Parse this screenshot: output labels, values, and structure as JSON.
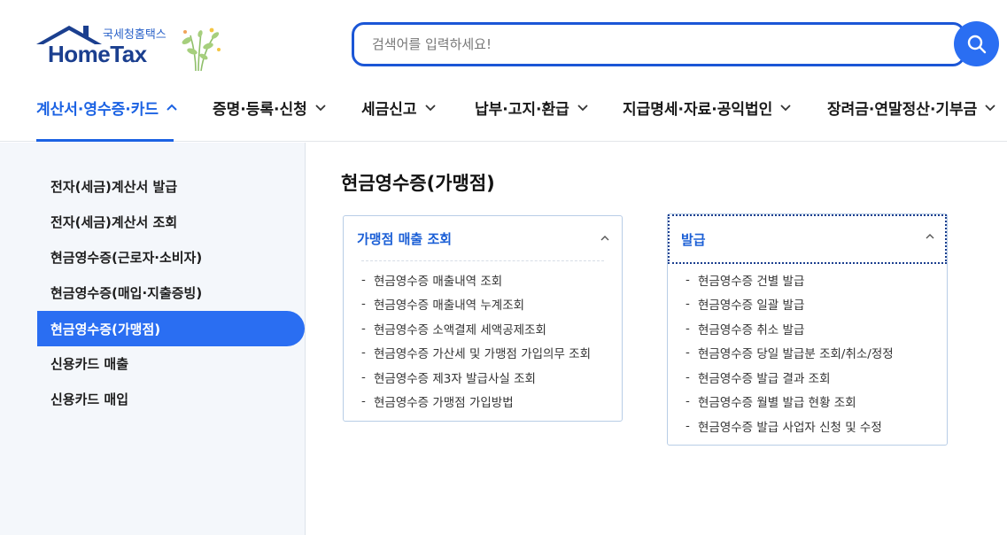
{
  "header": {
    "logo_kr": "국세청홈택스",
    "logo_en": "HomeTax",
    "search_placeholder": "검색어를 입력하세요!"
  },
  "gnb": [
    {
      "label": "계산서·영수증·카드",
      "active": true
    },
    {
      "label": "증명·등록·신청"
    },
    {
      "label": "세금신고"
    },
    {
      "label": "납부·고지·환급"
    },
    {
      "label": "지급명세·자료·공익법인"
    },
    {
      "label": "장려금·연말정산·기부금"
    }
  ],
  "sidebar": {
    "items": [
      {
        "label": "전자(세금)계산서 발급"
      },
      {
        "label": "전자(세금)계산서 조회"
      },
      {
        "label": "현금영수증(근로자·소비자)"
      },
      {
        "label": "현금영수증(매입·지출증빙)"
      },
      {
        "label": "현금영수증(가맹점)",
        "active": true
      },
      {
        "label": "신용카드 매출"
      },
      {
        "label": "신용카드 매입"
      }
    ]
  },
  "main": {
    "title": "현금영수증(가맹점)",
    "cards": [
      {
        "title": "가맹점 매출 조회",
        "items": [
          "현금영수증 매출내역 조회",
          "현금영수증 매출내역 누계조회",
          "현금영수증 소액결제 세액공제조회",
          "현금영수증 가산세 및 가맹점 가입의무 조회",
          "현금영수증 제3자 발급사실 조회",
          "현금영수증 가맹점 가입방법"
        ]
      },
      {
        "title": "발급",
        "items": [
          "현금영수증 건별 발급",
          "현금영수증 일괄 발급",
          "현금영수증 취소 발급",
          "현금영수증 당일 발급분 조회/취소/정정",
          "현금영수증 발급 결과 조회",
          "현금영수증 월별 발급 현황 조회",
          "현금영수증 발급 사업자 신청 및 수정"
        ]
      }
    ]
  },
  "colors": {
    "accent": "#2a6ef2",
    "active_text": "#1b62e3",
    "logo_navy": "#1b3f8f",
    "sidebar_bg": "#f4f7fb"
  }
}
